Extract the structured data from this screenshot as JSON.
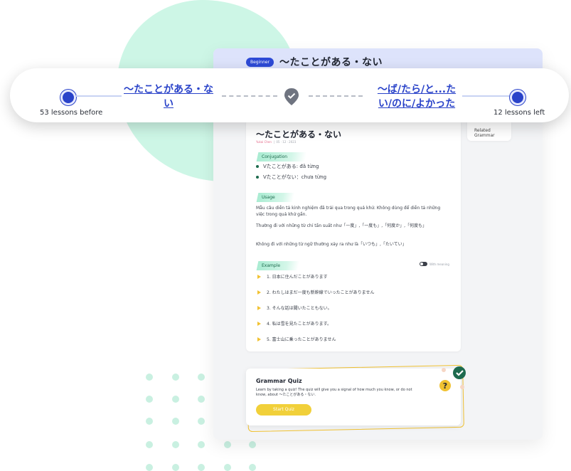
{
  "header": {
    "level_badge": "Beginner",
    "title": "〜たことがある・ない"
  },
  "progress": {
    "previous_lesson": "〜たことがある・ない",
    "next_lesson": "〜ば/たら/と...たい/のに/よかった",
    "lessons_before": "53 lessons before",
    "lessons_left": "12 lessons left"
  },
  "sidebar": {
    "related_label": "Related Grammar"
  },
  "lesson": {
    "title": "〜たことがある・ない",
    "author": "Yukai Chen",
    "date": "05 · 12 · 2023",
    "conjugation_label": "Conjugation",
    "conjugations": [
      "Vたことがある: đã từng",
      "Vたことがない：chưa từng"
    ],
    "usage_label": "Usage",
    "usage": [
      "Mẫu câu diễn tả kinh nghiệm đã trải qua trong quá khứ. Không dùng để diễn tả những việc trong quá khứ gần.",
      "Thường đi với những từ chỉ tần suất như「一度」,「一度も」,「何度か」,「何度も」",
      "Không đi với những từ ngữ thường xảy ra như là「いつも」,「たいてい」"
    ],
    "example_label": "Example",
    "meaning_toggle_label": "With meaning",
    "examples": [
      "1. 日本に住んだことがあります",
      "2. わたしはまだ一度も新幹線でいったことがありません",
      "3. そんな話は聞いたこともない。",
      "4. 私は雪を見たことがあります。",
      "5. 富士山に乗ったことがありません"
    ]
  },
  "quiz": {
    "title": "Grammar Quiz",
    "description": "Learn by taking a quiz! The quiz will give you a signal of how much you know, or do not know, about 〜たことがある・ない.",
    "button": "Start Quiz"
  },
  "colors": {
    "accent": "#2a43c9",
    "quiz_button": "#f1d03a",
    "tag_green": "#a9ecd2"
  }
}
